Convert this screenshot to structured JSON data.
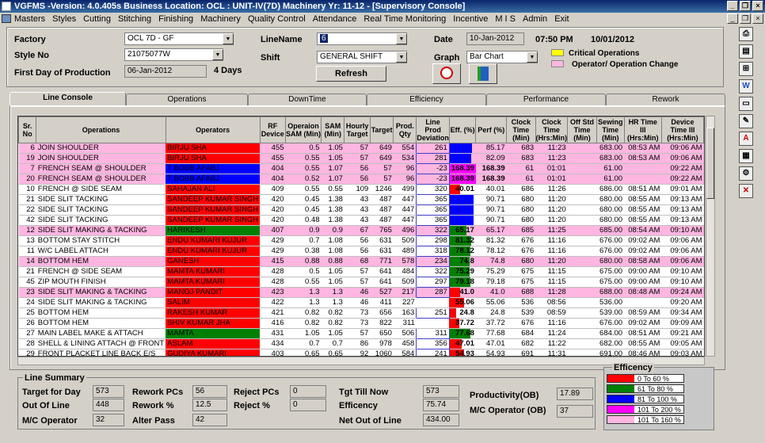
{
  "window": {
    "title": "VGFMS -Version: 4.0.405s Business Location: OCL : UNIT-IV(7D)   Machinery Yr: 11-12  - [Supervisory Console]"
  },
  "menu": [
    "Masters",
    "Styles",
    "Cutting",
    "Stitching",
    "Finishing",
    "Machinery",
    "Quality Control",
    "Attendance",
    "Real Time Monitoring",
    "Incentive",
    "M I S",
    "Admin",
    "Exit"
  ],
  "header": {
    "factory_label": "Factory",
    "factory_value": "OCL 7D - GF",
    "style_label": "Style No",
    "style_value": "21075077W",
    "first_day_label": "First Day of Production",
    "first_day_value": "06-Jan-2012",
    "days": "4 Days",
    "linename_label": "LineName",
    "linename_value": "6",
    "shift_label": "Shift",
    "shift_value": "GENERAL SHIFT",
    "refresh_label": "Refresh",
    "date_label": "Date",
    "date_value": "10-Jan-2012",
    "time": "07:50 PM",
    "date2": "10/01/2012",
    "graph_label": "Graph",
    "graph_value": "Bar Chart",
    "legend_critical": "Critical Operations",
    "legend_change": "Operator/ Operation Change",
    "critical_color": "#ffff00",
    "change_color": "#ffb6e1"
  },
  "tabs": [
    "Line Console",
    "Operations",
    "DownTime",
    "Efficiency",
    "Performance",
    "Rework"
  ],
  "columns": [
    "Sr. No",
    "Operations",
    "Operators",
    "RF Device",
    "Operaion SAM (Min)",
    "SAM (Min)",
    "Hourly Target",
    "Target",
    "Prod. Qty",
    "Line Prod Deviation",
    "Eff. (%)",
    "Perf (%)",
    "Clock Time (Min)",
    "Clock Time (Hrs:Min)",
    "Off Std Time (Min)",
    "Sewing Time (Min)",
    "HR Time III (Hrs:Min)",
    "Device Time III (Hrs:Min)"
  ],
  "rows": [
    {
      "sr": "6",
      "op": "JOIN SHOULDER",
      "opr": "BIRJU SHA",
      "rf": "455",
      "osam": "0.5",
      "sam": "1.05",
      "ht": "57",
      "tgt": "649",
      "pq": "554",
      "dev": "261",
      "eff": "",
      "perf": "85.17",
      "ct": "683",
      "cth": "11:23",
      "off": "",
      "sew": "683.00",
      "hr": "08:53 AM",
      "dt": "09:06 AM",
      "bg": "#ffb6e1",
      "oc": "#ff0000",
      "ec": "#0000ff",
      "ev": 0.85
    },
    {
      "sr": "19",
      "op": "JOIN SHOULDER",
      "opr": "BIRJU SHA",
      "rf": "455",
      "osam": "0.55",
      "sam": "1.05",
      "ht": "57",
      "tgt": "649",
      "pq": "534",
      "dev": "281",
      "eff": "",
      "perf": "82.09",
      "ct": "683",
      "cth": "11:23",
      "off": "",
      "sew": "683.00",
      "hr": "08:53 AM",
      "dt": "09:06 AM",
      "bg": "#ffb6e1",
      "oc": "#ff0000",
      "ec": "#0000ff",
      "ev": 0.82
    },
    {
      "sr": "7",
      "op": "FRENCH SEAM @ SHOULDER",
      "opr": "T BOBB AFABJ",
      "rf": "404",
      "osam": "0.55",
      "sam": "1.07",
      "ht": "56",
      "tgt": "57",
      "pq": "96",
      "dev": "-23",
      "eff": "168.39",
      "perf": "168.39",
      "ct": "61",
      "cth": "01:01",
      "off": "",
      "sew": "61.00",
      "hr": "",
      "dt": "09:22 AM",
      "bg": "#ffb6e1",
      "oc": "#0000ff",
      "ec": "#ff00ff",
      "ev": 1
    },
    {
      "sr": "20",
      "op": "FRENCH SEAM @ SHOULDER",
      "opr": "T BOBB AFABJ",
      "rf": "404",
      "osam": "0.52",
      "sam": "1.07",
      "ht": "56",
      "tgt": "57",
      "pq": "96",
      "dev": "-23",
      "eff": "168.39",
      "perf": "168.39",
      "ct": "61",
      "cth": "01:01",
      "off": "",
      "sew": "61.00",
      "hr": "",
      "dt": "09:22 AM",
      "bg": "#ffb6e1",
      "oc": "#0000ff",
      "ec": "#ff00ff",
      "ev": 1
    },
    {
      "sr": "10",
      "op": "FRENCH @ SIDE SEAM",
      "opr": "SAHAJAN  ALI",
      "rf": "409",
      "osam": "0.55",
      "sam": "0.55",
      "ht": "109",
      "tgt": "1246",
      "pq": "499",
      "dev": "320",
      "eff": "40.01",
      "perf": "40.01",
      "ct": "686",
      "cth": "11:26",
      "off": "",
      "sew": "686.00",
      "hr": "08:51 AM",
      "dt": "09:01 AM",
      "bg": "#ffffff",
      "oc": "#ff0000",
      "ec": "#ff0000",
      "ev": 0.4
    },
    {
      "sr": "21",
      "op": "SIDE SLIT TACKING",
      "opr": "SANDEEP KUMAR SINGH",
      "rf": "420",
      "osam": "0.45",
      "sam": "1.38",
      "ht": "43",
      "tgt": "487",
      "pq": "447",
      "dev": "365",
      "eff": "",
      "perf": "90.71",
      "ct": "680",
      "cth": "11:20",
      "off": "",
      "sew": "680.00",
      "hr": "08:55 AM",
      "dt": "09:13 AM",
      "bg": "#ffffff",
      "oc": "#ff0000",
      "ec": "#0000ff",
      "ev": 0.9
    },
    {
      "sr": "22",
      "op": "SIDE SLIT TACKING",
      "opr": "SANDEEP KUMAR SINGH",
      "rf": "420",
      "osam": "0.45",
      "sam": "1.38",
      "ht": "43",
      "tgt": "487",
      "pq": "447",
      "dev": "365",
      "eff": "",
      "perf": "90.71",
      "ct": "680",
      "cth": "11:20",
      "off": "",
      "sew": "680.00",
      "hr": "08:55 AM",
      "dt": "09:13 AM",
      "bg": "#ffffff",
      "oc": "#ff0000",
      "ec": "#0000ff",
      "ev": 0.9
    },
    {
      "sr": "42",
      "op": "SIDE SLIT TACKING",
      "opr": "SANDEEP KUMAR SINGH",
      "rf": "420",
      "osam": "0.48",
      "sam": "1.38",
      "ht": "43",
      "tgt": "487",
      "pq": "447",
      "dev": "365",
      "eff": "",
      "perf": "90.71",
      "ct": "680",
      "cth": "11:20",
      "off": "",
      "sew": "680.00",
      "hr": "08:55 AM",
      "dt": "09:13 AM",
      "bg": "#ffffff",
      "oc": "#ff0000",
      "ec": "#0000ff",
      "ev": 0.9
    },
    {
      "sr": "12",
      "op": "SIDE SLIT MAKING & TACKING",
      "opr": "HARIKESH",
      "rf": "407",
      "osam": "0.9",
      "sam": "0.9",
      "ht": "67",
      "tgt": "765",
      "pq": "496",
      "dev": "322",
      "eff": "65.17",
      "perf": "65.17",
      "ct": "685",
      "cth": "11:25",
      "off": "",
      "sew": "685.00",
      "hr": "08:54 AM",
      "dt": "09:10 AM",
      "bg": "#ffb6e1",
      "oc": "#008000",
      "ec": "#008000",
      "ev": 0.65
    },
    {
      "sr": "13",
      "op": "BOTTOM STAY STITCH",
      "opr": "ENDU KUMARI KUJUR",
      "rf": "429",
      "osam": "0.7",
      "sam": "1.08",
      "ht": "56",
      "tgt": "631",
      "pq": "509",
      "dev": "298",
      "eff": "81.32",
      "perf": "81.32",
      "ct": "676",
      "cth": "11:16",
      "off": "",
      "sew": "676.00",
      "hr": "09:02 AM",
      "dt": "09:06 AM",
      "bg": "#ffffff",
      "oc": "#ff0000",
      "ec": "#008000",
      "ev": 0.81
    },
    {
      "sr": "11",
      "op": "W/C LABEL ATTACH",
      "opr": "ENDU KUMARI KUJUR",
      "rf": "429",
      "osam": "0.38",
      "sam": "1.08",
      "ht": "56",
      "tgt": "631",
      "pq": "489",
      "dev": "318",
      "eff": "78.12",
      "perf": "78.12",
      "ct": "676",
      "cth": "11:16",
      "off": "",
      "sew": "676.00",
      "hr": "09:02 AM",
      "dt": "09:06 AM",
      "bg": "#ffffff",
      "oc": "#ff0000",
      "ec": "#008000",
      "ev": 0.78
    },
    {
      "sr": "14",
      "op": "BOTTOM HEM",
      "opr": "GANESH",
      "rf": "415",
      "osam": "0.88",
      "sam": "0.88",
      "ht": "68",
      "tgt": "771",
      "pq": "578",
      "dev": "234",
      "eff": "74.8",
      "perf": "74.8",
      "ct": "680",
      "cth": "11:20",
      "off": "",
      "sew": "680.00",
      "hr": "08:58 AM",
      "dt": "09:06 AM",
      "bg": "#ffb6e1",
      "oc": "#ff0000",
      "ec": "#008000",
      "ev": 0.75
    },
    {
      "sr": "21",
      "op": "FRENCH @ SIDE SEAM",
      "opr": "MAMTA KUMARI",
      "rf": "428",
      "osam": "0.5",
      "sam": "1.05",
      "ht": "57",
      "tgt": "641",
      "pq": "484",
      "dev": "322",
      "eff": "75.29",
      "perf": "75.29",
      "ct": "675",
      "cth": "11:15",
      "off": "",
      "sew": "675.00",
      "hr": "09:00 AM",
      "dt": "09:10 AM",
      "bg": "#ffffff",
      "oc": "#ff0000",
      "ec": "#008000",
      "ev": 0.75
    },
    {
      "sr": "45",
      "op": "ZIP MOUTH FINISH",
      "opr": "MAMTA KUMARI",
      "rf": "428",
      "osam": "0.55",
      "sam": "1.05",
      "ht": "57",
      "tgt": "641",
      "pq": "509",
      "dev": "297",
      "eff": "79.18",
      "perf": "79.18",
      "ct": "675",
      "cth": "11:15",
      "off": "",
      "sew": "675.00",
      "hr": "09:00 AM",
      "dt": "09:10 AM",
      "bg": "#ffffff",
      "oc": "#ff0000",
      "ec": "#008000",
      "ev": 0.79
    },
    {
      "sr": "23",
      "op": "SIDE SLIT MAKING & TACKING",
      "opr": "MANOJ  PANDIT",
      "rf": "423",
      "osam": "1.3",
      "sam": "1.3",
      "ht": "46",
      "tgt": "527",
      "pq": "217",
      "dev": "287",
      "eff": "41.0",
      "perf": "41.0",
      "ct": "688",
      "cth": "11:28",
      "off": "",
      "sew": "688.00",
      "hr": "08:48 AM",
      "dt": "09:24 AM",
      "bg": "#ffb6e1",
      "oc": "#ff0000",
      "ec": "#ff0000",
      "ev": 0.41
    },
    {
      "sr": "24",
      "op": "SIDE SLIT MAKING & TACKING",
      "opr": "SALIM",
      "rf": "422",
      "osam": "1.3",
      "sam": "1.3",
      "ht": "46",
      "tgt": "411",
      "pq": "227",
      "dev": "",
      "eff": "55.06",
      "perf": "55.06",
      "ct": "536",
      "cth": "08:56",
      "off": "",
      "sew": "536.00",
      "hr": "",
      "dt": "09:20 AM",
      "bg": "#ffffff",
      "oc": "#ff0000",
      "ec": "#ff0000",
      "ev": 0.55
    },
    {
      "sr": "25",
      "op": "BOTTOM HEM",
      "opr": "RAKESH KUMAR",
      "rf": "421",
      "osam": "0.82",
      "sam": "0.82",
      "ht": "73",
      "tgt": "656",
      "pq": "163",
      "dev": "251",
      "eff": "24.8",
      "perf": "24.8",
      "ct": "539",
      "cth": "08:59",
      "off": "",
      "sew": "539.00",
      "hr": "08:59 AM",
      "dt": "09:34 AM",
      "bg": "#ffffff",
      "oc": "#ff0000",
      "ec": "#ff0000",
      "ev": 0.25
    },
    {
      "sr": "26",
      "op": "BOTTOM HEM",
      "opr": "SHIV KUMAR JHA",
      "rf": "416",
      "osam": "0.82",
      "sam": "0.82",
      "ht": "73",
      "tgt": "822",
      "pq": "311",
      "dev": "",
      "eff": "37.72",
      "perf": "37.72",
      "ct": "676",
      "cth": "11:16",
      "off": "",
      "sew": "676.00",
      "hr": "09:02 AM",
      "dt": "09:09 AM",
      "bg": "#ffffff",
      "oc": "#ff0000",
      "ec": "#ff0000",
      "ev": 0.38
    },
    {
      "sr": "27",
      "op": "MAIN LABEL MAKE & ATTACH",
      "opr": "MAMTA",
      "rf": "431",
      "osam": "1.05",
      "sam": "1.05",
      "ht": "57",
      "tgt": "650",
      "pq": "506",
      "dev": "311",
      "eff": "77.68",
      "perf": "77.68",
      "ct": "684",
      "cth": "11:24",
      "off": "",
      "sew": "684.00",
      "hr": "08:51 AM",
      "dt": "09:21 AM",
      "bg": "#ffffff",
      "oc": "#008000",
      "ec": "#008000",
      "ev": 0.78
    },
    {
      "sr": "28",
      "op": "SHELL & LINING ATTACH @ FRONT",
      "opr": "ASLAM",
      "rf": "434",
      "osam": "0.7",
      "sam": "0.7",
      "ht": "86",
      "tgt": "978",
      "pq": "458",
      "dev": "356",
      "eff": "47.01",
      "perf": "47.01",
      "ct": "682",
      "cth": "11:22",
      "off": "",
      "sew": "682.00",
      "hr": "08:55 AM",
      "dt": "09:05 AM",
      "bg": "#ffffff",
      "oc": "#ff0000",
      "ec": "#ff0000",
      "ev": 0.47
    },
    {
      "sr": "29",
      "op": "FRONT PLACKET LINE BACK E/S",
      "opr": "GUDIYA KUMARI",
      "rf": "403",
      "osam": "0.65",
      "sam": "0.65",
      "ht": "92",
      "tgt": "1060",
      "pq": "584",
      "dev": "241",
      "eff": "54.93",
      "perf": "54.93",
      "ct": "691",
      "cth": "11:31",
      "off": "",
      "sew": "691.00",
      "hr": "08:46 AM",
      "dt": "09:03 AM",
      "bg": "#ffffff",
      "oc": "#ff0000",
      "ec": "#ff0000",
      "ev": 0.55
    }
  ],
  "summary": {
    "caption": "Line Summary",
    "target_label": "Target for Day",
    "target_value": "573",
    "out_label": "Out Of Line",
    "out_value": "448",
    "mc_label": "M/C Operator",
    "mc_value": "32",
    "rework_pcs_label": "Rework PCs",
    "rework_pcs_value": "56",
    "rework_pct_label": "Rework %",
    "rework_pct_value": "12.5",
    "alter_label": "Alter Pass",
    "alter_value": "42",
    "reject_pcs_label": "Reject PCs",
    "reject_pcs_value": "0",
    "reject_pct_label": "Reject %",
    "reject_pct_value": "0",
    "tgt_till_label": "Tgt Till Now",
    "tgt_till_value": "573",
    "efficency_label": "Efficency",
    "efficency_value": "75.74",
    "net_out_label": "Net Out of Line",
    "net_out_value": "434.00",
    "productivity_label": "Productivity(OB)",
    "productivity_value": "17.89",
    "mc_ob_label": "M/C Operator (OB)",
    "mc_ob_value": "37"
  },
  "eff_legend": {
    "caption": "Efficency",
    "items": [
      {
        "label": "0 To 60 %",
        "color": "#ff0000"
      },
      {
        "label": "61 To 80 %",
        "color": "#008000"
      },
      {
        "label": "81 To 100 %",
        "color": "#0000ff"
      },
      {
        "label": "101 To 200 %",
        "color": "#ff00ff"
      },
      {
        "label": "101 To 160 %",
        "color": "#ffb6e1"
      }
    ]
  }
}
